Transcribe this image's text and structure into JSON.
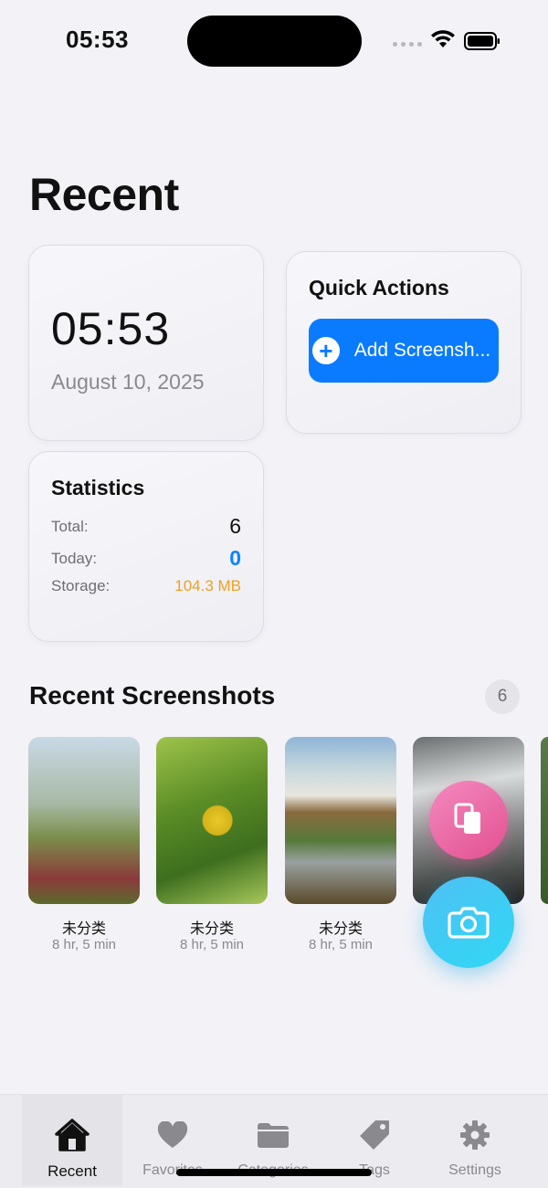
{
  "status_bar": {
    "time": "05:53"
  },
  "page": {
    "title": "Recent"
  },
  "clock_card": {
    "time": "05:53",
    "date": "August 10, 2025"
  },
  "quick_actions": {
    "title": "Quick Actions",
    "add_button_label": "Add Screensh..."
  },
  "statistics": {
    "title": "Statistics",
    "total_label": "Total:",
    "total_value": "6",
    "today_label": "Today:",
    "today_value": "0",
    "storage_label": "Storage:",
    "storage_value": "104.3 MB"
  },
  "recent_screenshots": {
    "title": "Recent Screenshots",
    "count": "6",
    "items": [
      {
        "category": "未分类",
        "time": "8 hr, 5 min"
      },
      {
        "category": "未分类",
        "time": "8 hr, 5 min"
      },
      {
        "category": "未分类",
        "time": "8 hr, 5 min"
      }
    ]
  },
  "fabs": {
    "secondary_icon": "copy-icon",
    "primary_icon": "camera-icon"
  },
  "tab_bar": {
    "tabs": [
      {
        "label": "Recent",
        "icon": "house-icon"
      },
      {
        "label": "Favorites",
        "icon": "heart-icon"
      },
      {
        "label": "Categories",
        "icon": "folder-icon"
      },
      {
        "label": "Tags",
        "icon": "tag-icon"
      },
      {
        "label": "Settings",
        "icon": "gear-icon"
      }
    ]
  },
  "colors": {
    "accent": "#0a7bff",
    "today": "#0a84ff",
    "storage": "#f0a020",
    "fab_pink": "#e2508f",
    "fab_blue": "#2fd8f3"
  }
}
